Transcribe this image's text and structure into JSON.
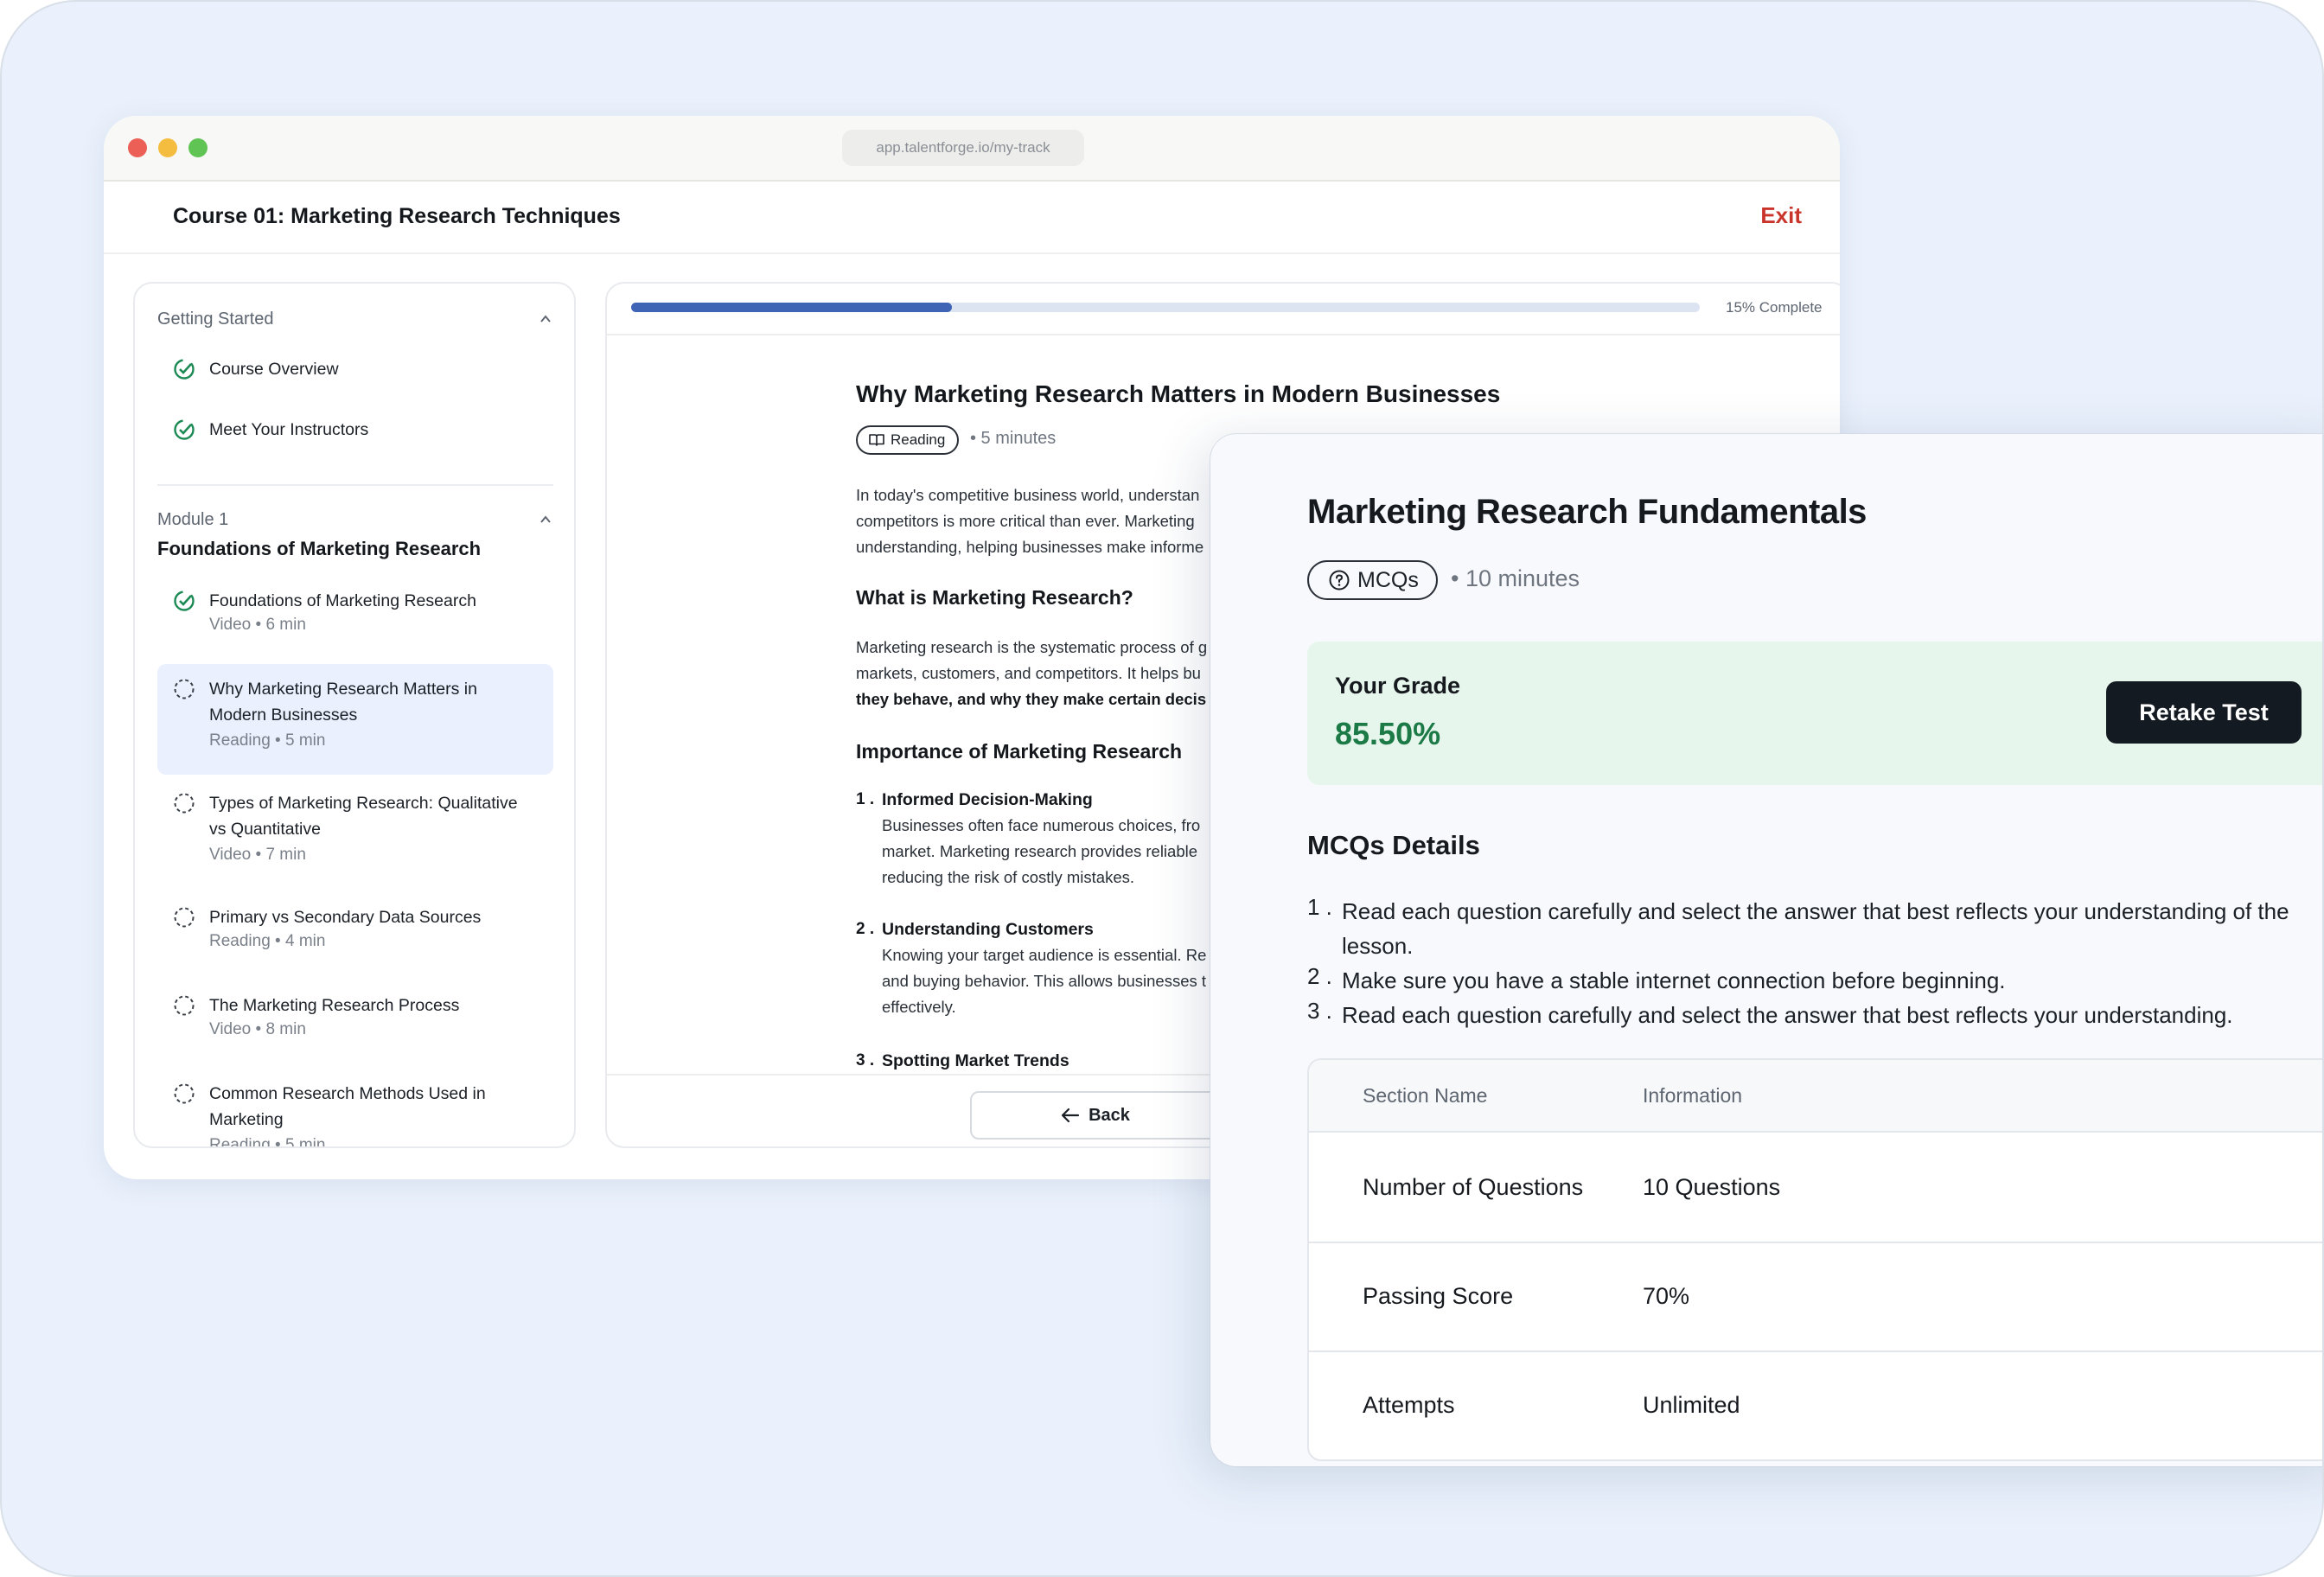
{
  "browser": {
    "url": "app.talentforge.io/my-track"
  },
  "header": {
    "course_title": "Course 01: Marketing Research Techniques",
    "exit_label": "Exit"
  },
  "sidebar": {
    "getting_started": {
      "heading": "Getting Started",
      "items": [
        {
          "label": "Course Overview",
          "status": "completed"
        },
        {
          "label": "Meet Your Instructors",
          "status": "completed"
        }
      ]
    },
    "module": {
      "heading": "Module 1",
      "title": "Foundations of Marketing Research",
      "items": [
        {
          "label": "Foundations of Marketing Research",
          "meta": "Video  •  6 min",
          "status": "completed"
        },
        {
          "label": "Why Marketing Research Matters in Modern Businesses",
          "meta": "Reading  •  5 min",
          "status": "active"
        },
        {
          "label": "Types of Marketing Research: Qualitative vs Quantitative",
          "meta": "Video  •  7 min",
          "status": "pending"
        },
        {
          "label": "Primary vs Secondary Data Sources",
          "meta": "Reading  •  4 min",
          "status": "pending"
        },
        {
          "label": "The Marketing Research Process",
          "meta": "Video  •  8 min",
          "status": "pending"
        },
        {
          "label": "Common Research Methods Used in Marketing",
          "meta": "Reading  •  5 min",
          "status": "pending"
        }
      ]
    }
  },
  "progress": {
    "value": 0.3,
    "label": "15% Complete"
  },
  "lesson": {
    "title": "Why Marketing Research Matters in Modern Businesses",
    "type_label": "Reading",
    "duration": "•  5 minutes",
    "intro_lines": [
      "In today's competitive business world, understan",
      "competitors is more critical than ever. Marketing",
      "understanding, helping businesses make informe"
    ],
    "section1_heading": "What is Marketing Research?",
    "section1_lines": [
      "Marketing research is the systematic process of g",
      "markets, customers, and competitors. It helps bu",
      "they behave, and why they make certain decis"
    ],
    "section2_heading": "Importance of Marketing Research",
    "list": [
      {
        "num": "1 .",
        "title": "Informed Decision-Making",
        "lines": [
          "Businesses often face numerous choices, fro",
          "market. Marketing research provides reliable",
          "reducing the risk of costly mistakes."
        ]
      },
      {
        "num": "2 .",
        "title": "Understanding Customers",
        "lines": [
          "Knowing your target audience is essential. Re",
          "and buying behavior. This allows businesses t",
          "effectively."
        ]
      },
      {
        "num": "3 .",
        "title": "Spotting Market Trends",
        "lines": []
      }
    ],
    "back_label": "Back"
  },
  "quiz": {
    "title": "Marketing Research Fundamentals",
    "type_label": "MCQs",
    "duration": "•  10 minutes",
    "grade_label": "Your Grade",
    "grade_value": "85.50%",
    "retake_label": "Retake Test",
    "details_heading": "MCQs Details",
    "instructions": [
      {
        "num": "1 .",
        "text": "Read each question carefully and select the answer that best reflects your understanding of the lesson."
      },
      {
        "num": "2 .",
        "text": "Make sure you have a stable internet connection before beginning."
      },
      {
        "num": "3 .",
        "text": "Read each question carefully and select the answer that best reflects your understanding."
      }
    ],
    "table": {
      "headers": [
        "Section Name",
        "Information"
      ],
      "rows": [
        [
          "Number of Questions",
          "10 Questions"
        ],
        [
          "Passing Score",
          "70%"
        ],
        [
          "Attempts",
          "Unlimited"
        ]
      ]
    }
  },
  "colors": {
    "background": "#eaf1fc",
    "accent": "#3f63b5",
    "exit": "#c9342b",
    "success": "#1c7a47",
    "grade_bg": "#e7f6ec",
    "dark_button": "#141a22"
  }
}
